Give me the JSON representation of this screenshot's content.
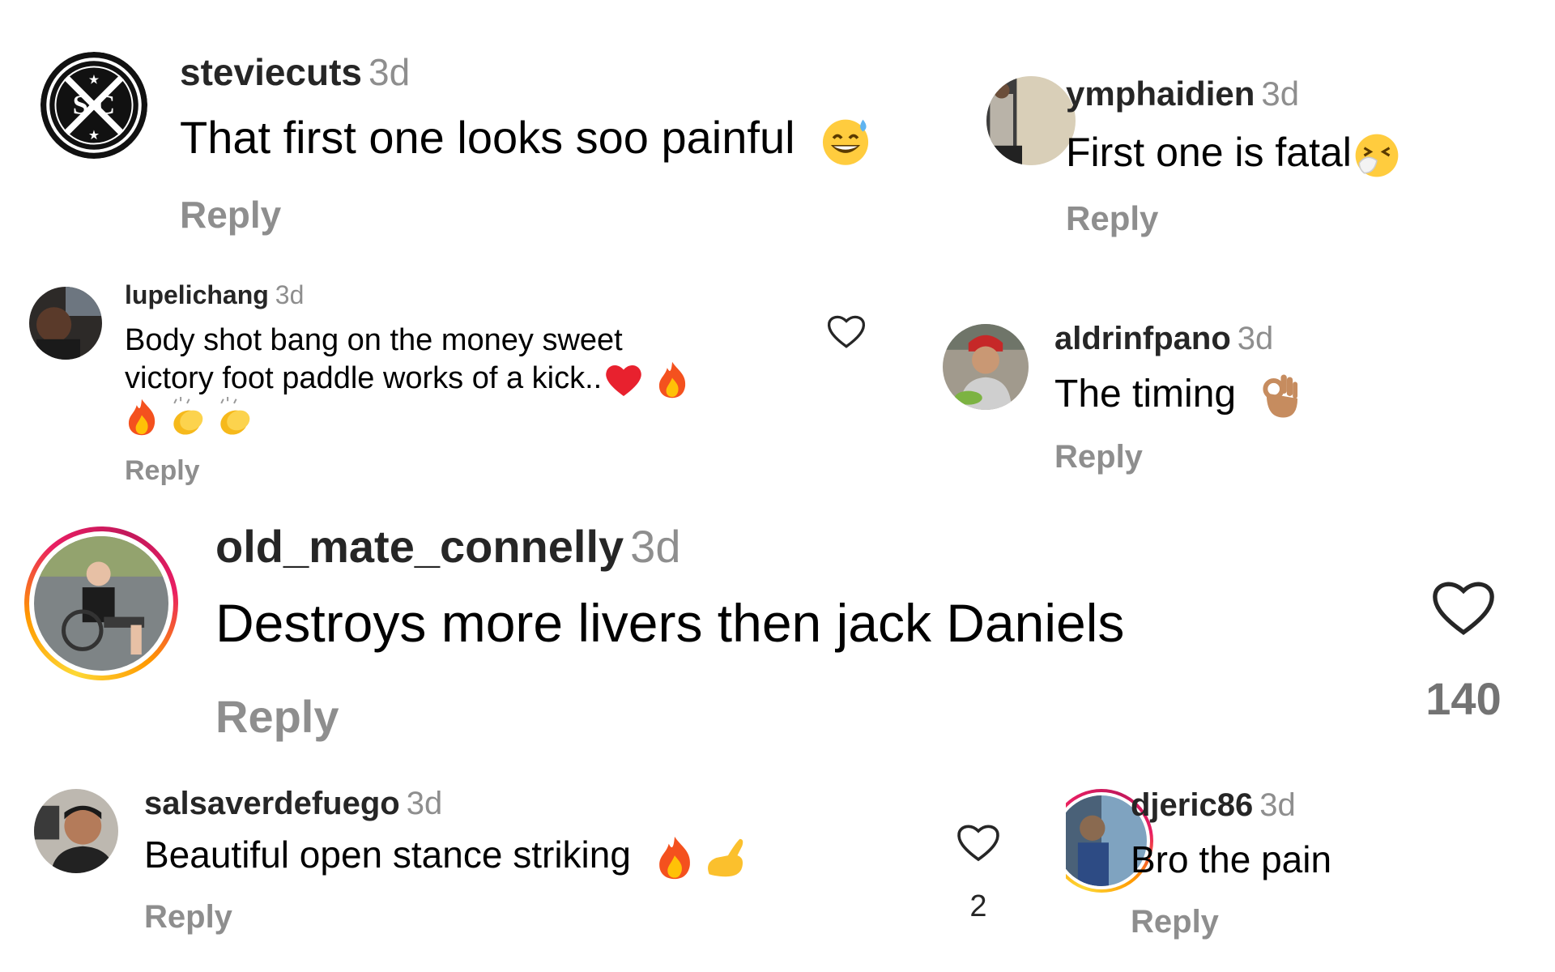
{
  "comments": [
    {
      "username": "steviecuts",
      "time": "3d",
      "text": "That first one looks soo painful",
      "reply": "Reply",
      "avatar_icon": "sc-barber-logo-icon",
      "emojis": [
        "sweat-smile-emoji"
      ]
    },
    {
      "username": "ymphaidien",
      "time": "3d",
      "text": "First one is fatal",
      "reply": "Reply",
      "avatar_icon": "user-photo",
      "emojis": [
        "sneezing-face-emoji"
      ]
    },
    {
      "username": "lupelichang",
      "time": "3d",
      "text_line1": "Body shot bang on the money sweet",
      "text_line2": "victory foot paddle works of a kick..",
      "reply": "Reply",
      "avatar_icon": "user-photo",
      "emojis": [
        "red-heart-emoji",
        "fire-emoji",
        "fire-emoji",
        "clapping-hands-emoji",
        "clapping-hands-emoji"
      ]
    },
    {
      "username": "aldrinfpano",
      "time": "3d",
      "text": "The timing",
      "reply": "Reply",
      "avatar_icon": "user-photo",
      "emojis": [
        "ok-hand-emoji"
      ]
    },
    {
      "username": "old_mate_connelly",
      "time": "3d",
      "text": "Destroys more livers then jack Daniels",
      "reply": "Reply",
      "likes": "140",
      "avatar_icon": "user-photo",
      "story_ring": true
    },
    {
      "username": "salsaverdefuego",
      "time": "3d",
      "text": "Beautiful open stance striking",
      "reply": "Reply",
      "likes": "2",
      "avatar_icon": "user-photo",
      "emojis": [
        "fire-emoji",
        "pinching-hand-emoji"
      ]
    },
    {
      "username": "djeric86",
      "time": "3d",
      "text": "Bro the pain",
      "reply": "Reply",
      "avatar_icon": "user-photo",
      "story_ring": true
    }
  ],
  "colors": {
    "username": "#262626",
    "timestamp": "#8e8e8e",
    "reply": "#8e8e8e",
    "likes": "#737373",
    "ring_gradient": [
      "#fdd835",
      "#ff9800",
      "#e91e63"
    ]
  }
}
